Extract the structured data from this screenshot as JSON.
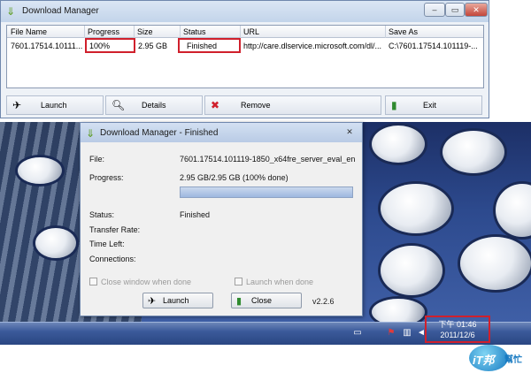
{
  "main_window": {
    "title": "Download Manager",
    "columns": [
      "File Name",
      "Progress",
      "Size",
      "Status",
      "URL",
      "Save As"
    ],
    "rows": [
      {
        "file_name": "7601.17514.10111...",
        "progress": "100%",
        "size": "2.95 GB",
        "status": "Finished",
        "url": "http://care.dlservice.microsoft.com/dl/...",
        "save_as": "C:\\7601.17514.101119-..."
      }
    ],
    "toolbar": {
      "launch": "Launch",
      "details": "Details",
      "remove": "Remove",
      "exit": "Exit"
    }
  },
  "dialog": {
    "title": "Download Manager - Finished",
    "labels": {
      "file": "File:",
      "progress": "Progress:",
      "status": "Status:",
      "transfer_rate": "Transfer Rate:",
      "time_left": "Time Left:",
      "connections": "Connections:"
    },
    "file": "7601.17514.101119-1850_x64fre_server_eval_en",
    "progress_text": "2.95 GB/2.95 GB (100% done)",
    "progress_fraction": 1.0,
    "status": "Finished",
    "close_window_when_done": "Close window when done",
    "launch_when_done": "Launch when done",
    "launch_button": "Launch",
    "close_button": "Close",
    "version": "v2.2.6"
  },
  "taskbar": {
    "time": "下午 01:46",
    "date": "2011/12/6"
  },
  "watermark": {
    "logo_text": "iT邦",
    "logo_sub": "幫忙"
  },
  "colors": {
    "highlight_red": "#d0202c",
    "taskbar_blue": "#3b5a9a",
    "titlebar_blue": "#c3d4ea"
  },
  "icons": [
    "download-arrow-icon",
    "launch-icon",
    "search-icon",
    "remove-x-icon",
    "exit-door-icon",
    "close-door-icon",
    "flag-icon",
    "speaker-icon",
    "network-icon"
  ]
}
